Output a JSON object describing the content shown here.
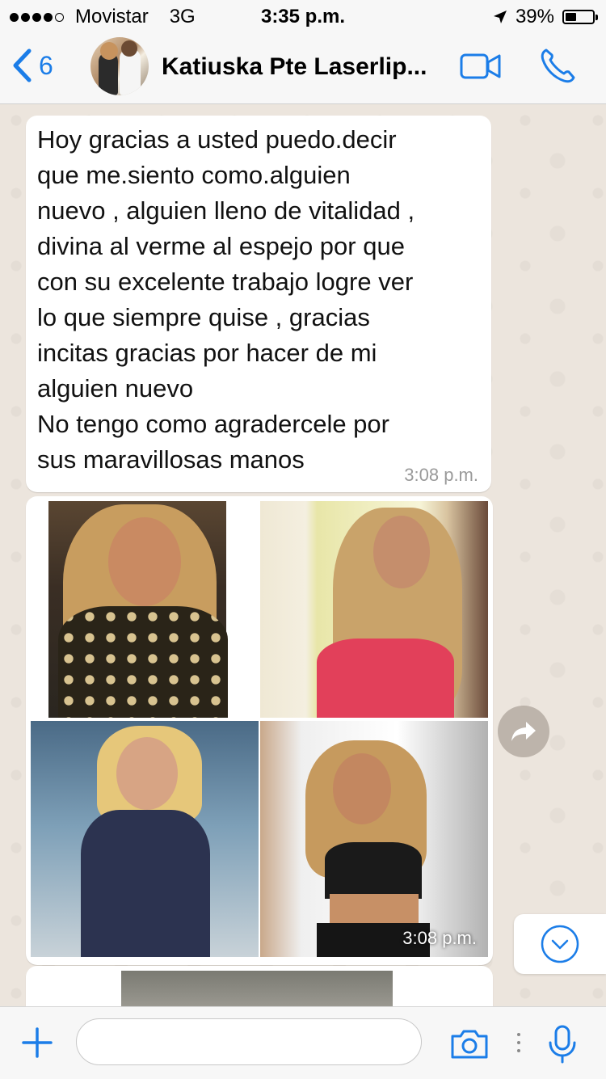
{
  "status_bar": {
    "carrier": "Movistar",
    "network": "3G",
    "time": "3:35 p.m.",
    "battery": "39%",
    "battery_level": 0.39,
    "signal_bars": 4
  },
  "header": {
    "back_count": "6",
    "contact_name": "Katiuska Pte Laserlip...",
    "accent_color": "#1b7de8"
  },
  "messages": [
    {
      "type": "text",
      "text": "Hoy gracias a usted puedo.decir\nque me.siento como.alguien\nnuevo , alguien lleno de vitalidad ,\ndivina al verme al espejo por que\ncon su excelente trabajo logre ver\nlo que siempre quise , gracias\nincitas gracias por hacer de mi\nalguien nuevo\nNo tengo como agradercele por\nsus maravillosas manos",
      "time": "3:08 p.m."
    },
    {
      "type": "photo_grid",
      "photo_count": 4,
      "time": "3:08 p.m."
    }
  ],
  "icons": {
    "back": "chevron-left-icon",
    "video": "video-camera-icon",
    "call": "phone-icon",
    "forward": "forward-arrow-icon",
    "scroll": "chevron-down-icon",
    "attach": "plus-icon",
    "camera": "camera-icon",
    "mic": "microphone-icon"
  },
  "input": {
    "placeholder": "",
    "value": ""
  }
}
